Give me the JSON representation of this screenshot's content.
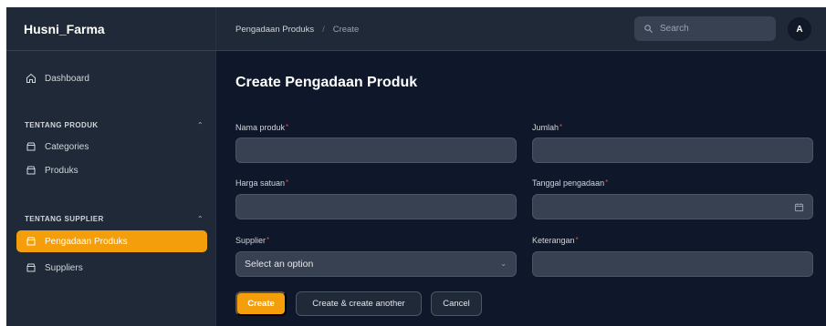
{
  "app": {
    "brand": "Husni_Farma"
  },
  "sidebar": {
    "dashboard": "Dashboard",
    "groups": [
      {
        "label": "TENTANG PRODUK",
        "items": [
          "Categories",
          "Produks"
        ]
      },
      {
        "label": "TENTANG SUPPLIER",
        "items": [
          "Pengadaan Produks",
          "Suppliers"
        ]
      }
    ],
    "active_item": "Pengadaan Produks"
  },
  "header": {
    "breadcrumb": [
      "Pengadaan Produks",
      "Create"
    ],
    "search_placeholder": "Search",
    "avatar_initial": "A"
  },
  "form": {
    "title": "Create Pengadaan Produk",
    "fields": {
      "nama_produk": {
        "label": "Nama produk",
        "value": ""
      },
      "jumlah": {
        "label": "Jumlah",
        "value": ""
      },
      "harga_satuan": {
        "label": "Harga satuan",
        "value": ""
      },
      "tanggal_pengadaan": {
        "label": "Tanggal pengadaan",
        "value": ""
      },
      "supplier": {
        "label": "Supplier",
        "value": "Select an option"
      },
      "keterangan": {
        "label": "Keterangan",
        "value": ""
      }
    },
    "required_marker": "*",
    "buttons": {
      "create": "Create",
      "create_another": "Create & create another",
      "cancel": "Cancel"
    }
  },
  "colors": {
    "accent": "#f59e0b",
    "sidebar_bg": "#1f2937",
    "main_bg": "#0f172a",
    "input_bg": "#374151"
  }
}
